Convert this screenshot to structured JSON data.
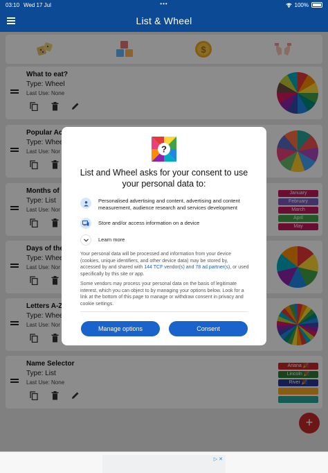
{
  "status": {
    "time": "03:10",
    "date": "Wed 17 Jul",
    "dots": "•••",
    "battery": "100%"
  },
  "app": {
    "title": "List & Wheel"
  },
  "categories": [
    {
      "name": "dice-icon"
    },
    {
      "name": "toy-blocks-icon"
    },
    {
      "name": "coin-icon"
    },
    {
      "name": "hands-icon"
    }
  ],
  "lists": [
    {
      "name": "What to eat?",
      "type": "Type: Wheel",
      "last_use": "Last Use: None",
      "display": "wheel"
    },
    {
      "name": "Popular Ac",
      "type": "Type: Whee",
      "last_use": "Last Use: Nor",
      "display": "wheel"
    },
    {
      "name": "Months of",
      "type": "Type: List",
      "last_use": "Last Use: Nor",
      "display": "tags",
      "tags": [
        "January",
        "February",
        "March",
        "April",
        "May"
      ]
    },
    {
      "name": "Days of the",
      "type": "Type: Whee",
      "last_use": "Last Use: Nor",
      "display": "wheel"
    },
    {
      "name": "Letters A-Z",
      "type": "Type: Whee",
      "last_use": "Last Use: Nor",
      "display": "wheel"
    },
    {
      "name": "Name Selector",
      "type": "Type: List",
      "last_use": "Last Use: None",
      "display": "tags",
      "tags": [
        "Ariana 🎉",
        "Lincoln 🎉",
        "River 🎉",
        "",
        ""
      ]
    }
  ],
  "tag_colors": [
    "#c2185b",
    "#7b5cc0",
    "#c2185b",
    "#43a047",
    "#c2185b"
  ],
  "name_tag_colors": [
    "#c62828",
    "#2e7d32",
    "#283593",
    "#f9a825",
    "#26a69a"
  ],
  "fab": {
    "label": "+"
  },
  "ad": {
    "choice": "▷ ✕"
  },
  "consent": {
    "title": "List and Wheel asks for your consent to use your personal data to:",
    "purposes": [
      "Personalised advertising and content, advertising and content measurement, audience research and services development",
      "Store and/or access information on a device"
    ],
    "learn_more": "Learn more",
    "para1_a": "Your personal data will be processed and information from your device (cookies, unique identifiers, and other device data) may be stored by, accessed by and shared with ",
    "para1_link": "144 TCF vendor(s) and 78 ad partner(s)",
    "para1_b": ", or used specifically by this site or app.",
    "para2": "Some vendors may process your personal data on the basis of legitimate interest, which you can object to by managing your options below. Look for a link at the bottom of this page to manage or withdraw consent in privacy and cookie settings.",
    "manage_label": "Manage options",
    "consent_label": "Consent"
  }
}
